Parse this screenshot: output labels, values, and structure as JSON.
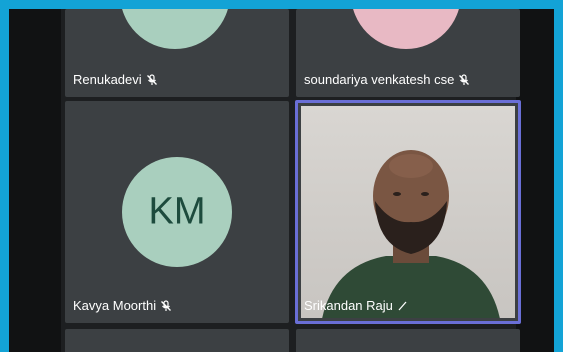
{
  "participants": [
    {
      "name": "Renukadevi",
      "muted": true
    },
    {
      "name": "soundariya venkatesh cse",
      "muted": true
    },
    {
      "name": "Kavya Moorthi",
      "muted": true,
      "initials": "KM"
    },
    {
      "name": "Srikandan Raju",
      "muted": false,
      "speaking": true
    }
  ],
  "colors": {
    "outer_border": "#13a3d6",
    "tile_bg": "#3c4043",
    "avatar_green": "#a9cfbe",
    "avatar_pink": "#e8b9c4",
    "speaking_border": "#6a6fd6"
  }
}
